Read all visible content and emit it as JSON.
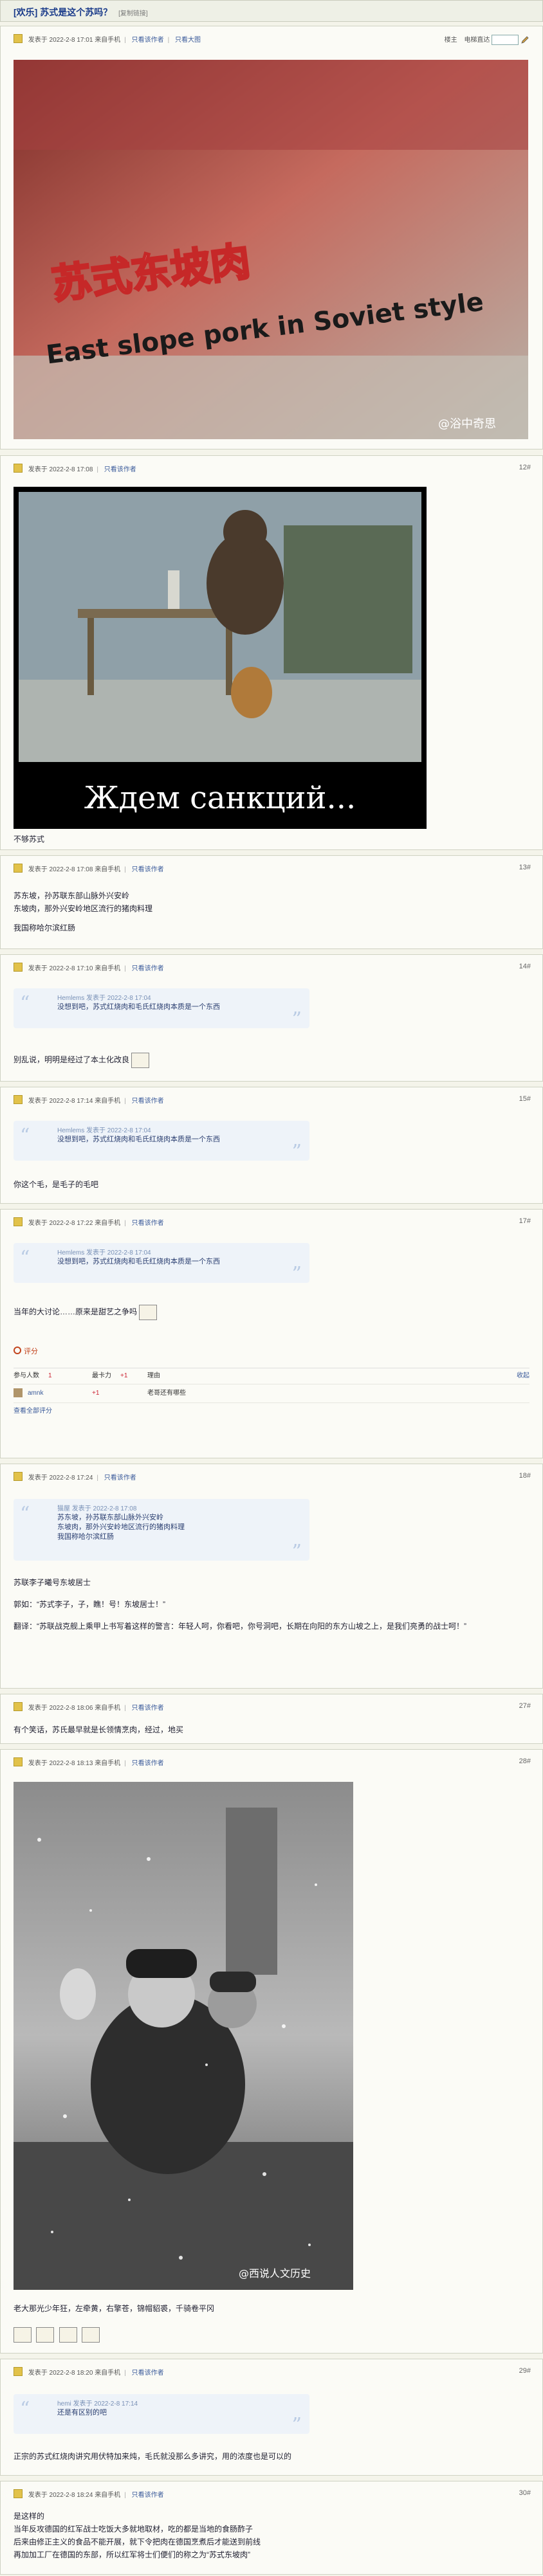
{
  "header": {
    "title": "[欢乐] 苏式是这个苏吗？",
    "tag": "[复制链接]"
  },
  "controls": {
    "only_author": "楼主",
    "elec_view": "电梯直达"
  },
  "posts": [
    {
      "author": "发表于 2022-2-8 17:01",
      "device": "来自手机",
      "only": "只看该作者",
      "bigpic": "只看大图",
      "caption_cn": "苏式东坡肉",
      "caption_en": "East slope pork in Soviet style",
      "watermark": "@浴中奇思"
    },
    {
      "author": "发表于 2022-2-8 17:08",
      "only": "只看该作者",
      "floor": "12#",
      "poster_text": "Ждем санкций...",
      "reply": "不够苏式"
    },
    {
      "author": "发表于 2022-2-8 17:08",
      "device": "来自手机",
      "only": "只看该作者",
      "floor": "13#",
      "lines": [
        "苏东坡，孙苏联东部山脉外兴安岭",
        "东坡肉，那外兴安岭地区流行的猪肉料理",
        "我国称哈尔滨红肠"
      ]
    },
    {
      "author": "发表于 2022-2-8 17:10",
      "device": "来自手机",
      "only": "只看该作者",
      "floor": "14#",
      "quote_head": "Hemlems 发表于 2022-2-8 17:04",
      "quote_text": "没想到吧，苏式红烧肉和毛氏红烧肉本质是一个东西",
      "reply": "别乱说，明明是经过了本土化改良"
    },
    {
      "author": "发表于 2022-2-8 17:14",
      "device": "来自手机",
      "only": "只看该作者",
      "floor": "15#",
      "quote_head": "Hemlems 发表于 2022-2-8 17:04",
      "quote_text": "没想到吧，苏式红烧肉和毛氏红烧肉本质是一个东西",
      "reply": "你这个毛，是毛子的毛吧"
    },
    {
      "author": "发表于 2022-2-8 17:22",
      "device": "来自手机",
      "only": "只看该作者",
      "floor": "17#",
      "quote_head": "Hemlems 发表于 2022-2-8 17:04",
      "quote_text": "没想到吧，苏式红烧肉和毛氏红烧肉本质是一个东西",
      "reply": "当年的大讨论……原来是甜艺之争吗",
      "rate": "评分",
      "rate_table": {
        "participants": "参与人数",
        "count": "1",
        "score_label": "最卡力",
        "score": "+1",
        "reason": "理由",
        "collapse": "收起",
        "row_user": "amnk",
        "row_score": "+1",
        "row_reason": "老哥还有哪些",
        "view_all": "查看全部评分"
      }
    },
    {
      "author": "发表于 2022-2-8 17:24",
      "only": "只看该作者",
      "floor": "18#",
      "quote_head": "猫屋 发表于 2022-2-8 17:08",
      "quote_lines": [
        "苏东坡，孙苏联东部山脉外兴安岭",
        "东坡肉，那外兴安岭地区流行的猪肉料理",
        "我国称哈尔滨红肠"
      ],
      "lines": [
        "苏联李子曦号东坡居士",
        "郭如：“苏式李子，子，瞧！号！东坡居士！”",
        "翻译：“苏联战克舰上乘甲上书写着这样的警言：年轻人呵，你看吧，你号洞吧，长期在向阳的东方山坡之上，是我们亮勇的战士呵！”"
      ]
    },
    {
      "author": "发表于 2022-2-8 18:06",
      "device": "来自手机",
      "only": "只看该作者",
      "floor": "27#",
      "reply": "有个笑话，苏氏最早就是长领情烹肉，经过，地买"
    },
    {
      "author": "发表于 2022-2-8 18:13",
      "device": "来自手机",
      "only": "只看该作者",
      "floor": "28#",
      "photo_wm": "@西说人文历史",
      "reply": "老大那光少年狂，左牵黄，右擎苍，锦帽貂裘，千骑卷平冈"
    },
    {
      "author": "发表于 2022-2-8 18:20",
      "device": "来自手机",
      "only": "只看该作者",
      "floor": "29#",
      "quote_head": "hemi 发表于 2022-2-8 17:14",
      "quote_text": "还是有区别的吧",
      "reply": "正宗的苏式红烧肉讲究用伏特加来炖，毛氏就没那么多讲究，用的浓度也是可以的"
    },
    {
      "author": "发表于 2022-2-8 18:24",
      "device": "来自手机",
      "only": "只看该作者",
      "floor": "30#",
      "lines": [
        "是这样的",
        "当年反攻德国的红军战士吃饭大多就地取材，吃的都是当地的食肠酢子",
        "后来由修正主义的食品不能开展，就下令把肉在德国烹煮后才能送到前线",
        "再加加工厂在德国的东部，所以红军将士们便们的称之为“苏式东坡肉”"
      ]
    }
  ]
}
